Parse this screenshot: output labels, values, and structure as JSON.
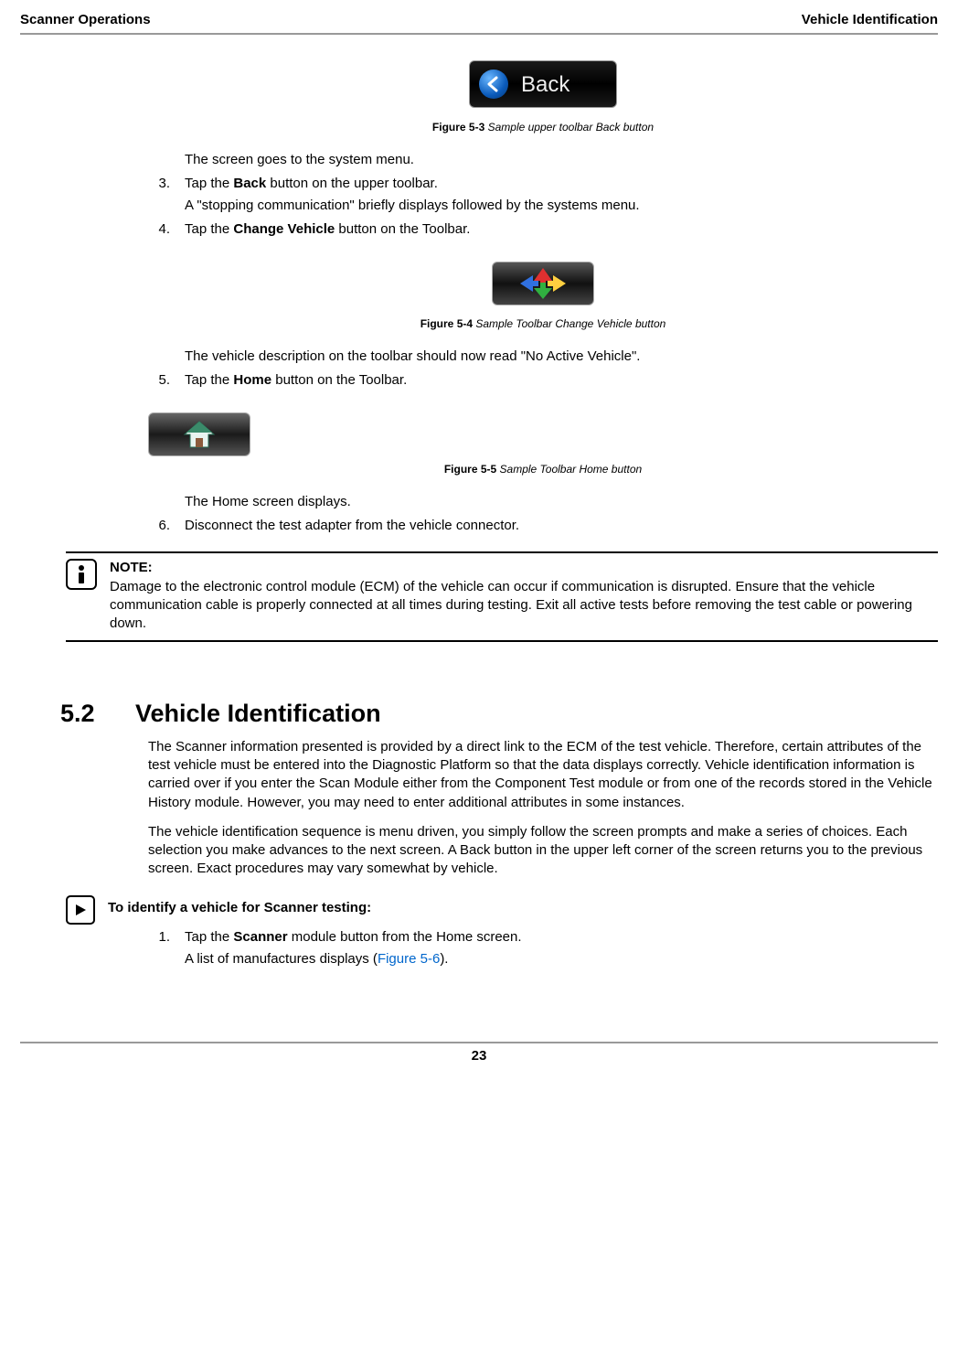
{
  "header": {
    "left": "Scanner Operations",
    "right": "Vehicle Identification"
  },
  "fig53": {
    "button_text": "Back",
    "caption_bold": "Figure 5-3",
    "caption_italic": " Sample upper toolbar Back button"
  },
  "step2_result": "The screen goes to the system menu.",
  "step3": {
    "num": "3.",
    "pre": "Tap the ",
    "bold": "Back",
    "post": " button on the upper toolbar.",
    "result": "A \"stopping communication\" briefly displays followed by the systems menu."
  },
  "step4": {
    "num": "4.",
    "pre": "Tap the ",
    "bold": "Change Vehicle",
    "post": " button on the Toolbar."
  },
  "fig54": {
    "caption_bold": "Figure 5-4",
    "caption_italic": " Sample Toolbar Change Vehicle button"
  },
  "step4_result": "The vehicle description on the toolbar should now read \"No Active Vehicle\".",
  "step5": {
    "num": "5.",
    "pre": "Tap the ",
    "bold": "Home",
    "post": " button on the Toolbar."
  },
  "fig55": {
    "caption_bold": "Figure 5-5",
    "caption_italic": " Sample Toolbar Home button"
  },
  "step5_result": "The Home screen displays.",
  "step6": {
    "num": "6.",
    "text": "Disconnect the test adapter from the vehicle connector."
  },
  "note": {
    "label": "NOTE:",
    "body": "Damage to the electronic control module (ECM) of the vehicle can occur if communication is disrupted. Ensure that the vehicle communication cable is properly connected at all times during testing. Exit all active tests before removing the test cable or powering down."
  },
  "section": {
    "num": "5.2",
    "title": "Vehicle Identification",
    "para1": "The Scanner information presented is provided by a direct link to the ECM of the test vehicle. Therefore, certain attributes of the test vehicle must be entered into the Diagnostic Platform so that the data displays correctly. Vehicle identification information is carried over if you enter the Scan Module either from the Component Test module or from one of the records stored in the Vehicle History module. However, you may need to enter additional attributes in some instances.",
    "para2": "The vehicle identification sequence is menu driven, you simply follow the screen prompts and make a series of choices. Each selection you make advances to the next screen. A Back button in the upper left corner of the screen returns you to the previous screen. Exact procedures may vary somewhat by vehicle."
  },
  "proc": {
    "title": "To identify a vehicle for Scanner testing:"
  },
  "pstep1": {
    "num": "1.",
    "pre": "Tap the ",
    "bold": "Scanner",
    "post": " module button from the Home screen.",
    "result_pre": "A list of manufactures displays (",
    "result_link": "Figure 5-6",
    "result_post": ")."
  },
  "page_number": "23"
}
